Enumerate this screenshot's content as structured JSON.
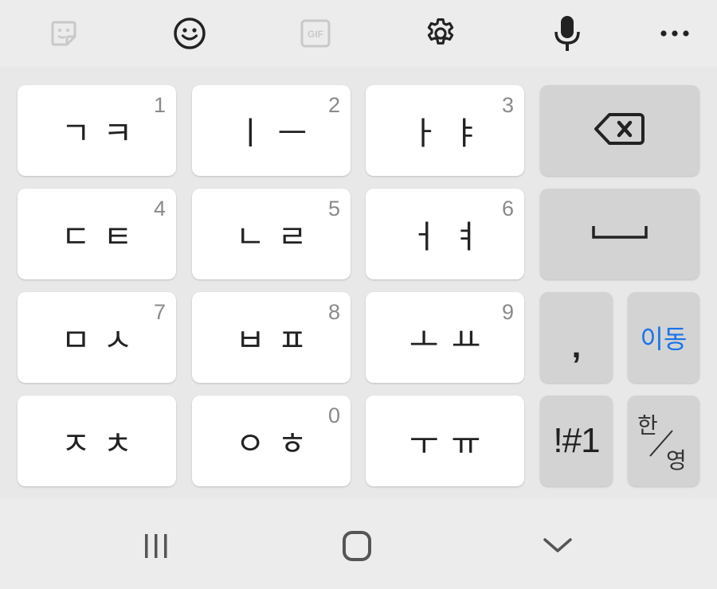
{
  "toolbar": {
    "icons": [
      "sticker-icon",
      "emoji-icon",
      "gif-icon",
      "settings-icon",
      "microphone-icon",
      "more-icon"
    ],
    "gif_label": "GIF"
  },
  "keys": {
    "row1": [
      {
        "main": "ㄱㅋ",
        "num": "1"
      },
      {
        "main": "ㅣㅡ",
        "num": "2"
      },
      {
        "main": "ㅏㅑ",
        "num": "3"
      }
    ],
    "row2": [
      {
        "main": "ㄷㅌ",
        "num": "4"
      },
      {
        "main": "ㄴㄹ",
        "num": "5"
      },
      {
        "main": "ㅓㅕ",
        "num": "6"
      }
    ],
    "row3": [
      {
        "main": "ㅁㅅ",
        "num": "7"
      },
      {
        "main": "ㅂㅍ",
        "num": "8"
      },
      {
        "main": "ㅗㅛ",
        "num": "9"
      }
    ],
    "row4": [
      {
        "main": "ㅈㅊ",
        "num": ""
      },
      {
        "main": "ㅇㅎ",
        "num": "0"
      },
      {
        "main": "ㅜㅠ",
        "num": ""
      }
    ],
    "comma": ",",
    "move": "이동",
    "symbols": "!#1",
    "lang_top": "한",
    "lang_bottom": "영"
  },
  "colors": {
    "accent": "#1a73e8",
    "key_bg": "#ffffff",
    "func_key_bg": "#d3d3d3",
    "background": "#ececec"
  }
}
